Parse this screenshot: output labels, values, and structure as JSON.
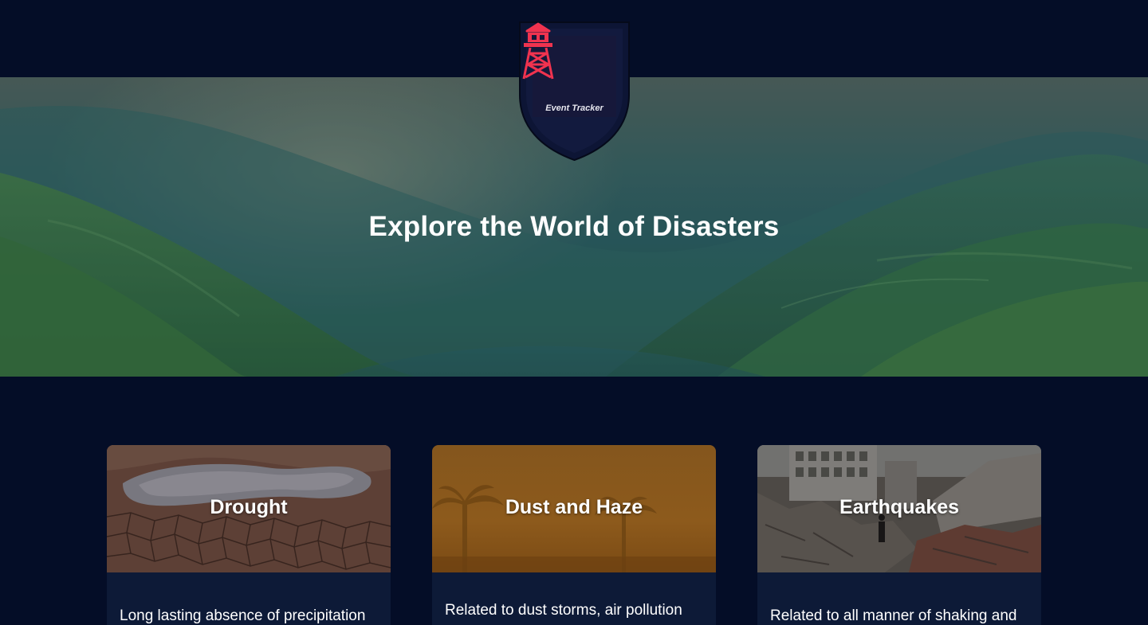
{
  "app": {
    "logo_label": "Event Tracker"
  },
  "hero": {
    "title": "Explore the World of Disasters"
  },
  "cards": [
    {
      "title": "Drought",
      "description": "Long lasting absence of precipitation"
    },
    {
      "title": "Dust and Haze",
      "description": "Related to dust storms, air pollution"
    },
    {
      "title": "Earthquakes",
      "description": "Related to all manner of shaking and"
    }
  ],
  "colors": {
    "page_background": "#040d27",
    "card_background": "#0d1a37",
    "logo_accent": "#f0334f",
    "logo_background": "#16183a"
  },
  "icons": {
    "logo": "watchtower-icon"
  }
}
